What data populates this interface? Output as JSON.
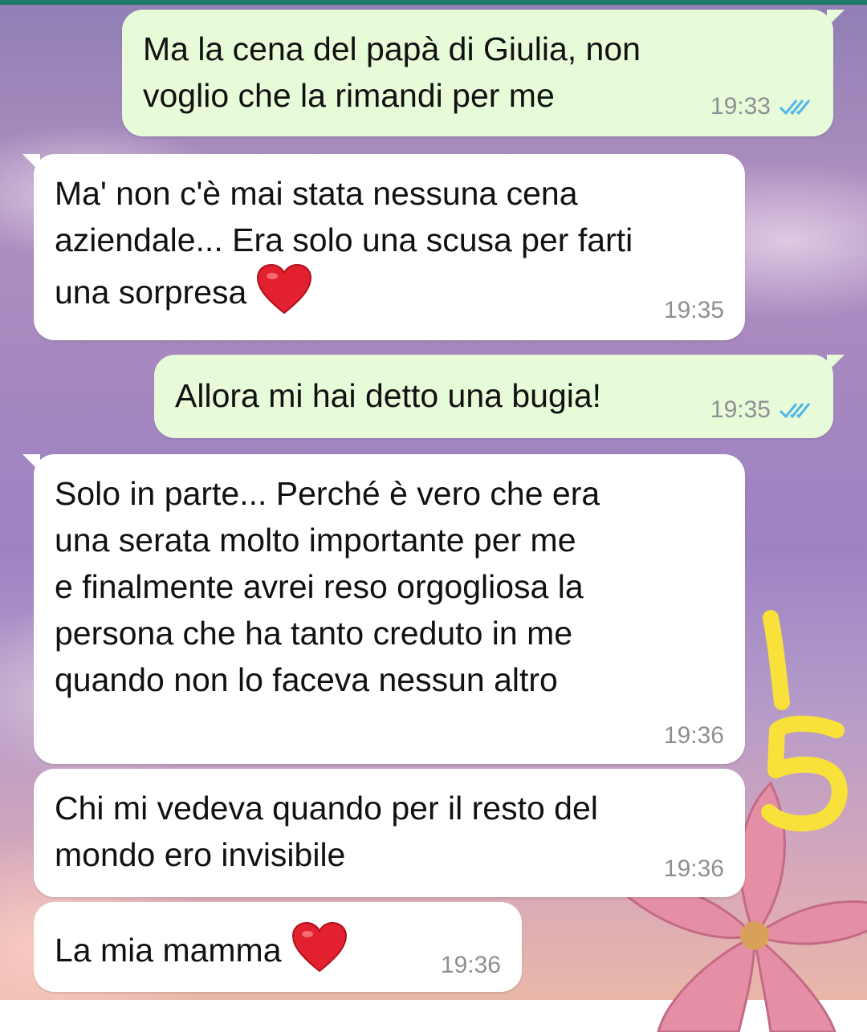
{
  "messages": [
    {
      "text": "Ma la cena del papà di Giulia, non\nvoglio che la rimandi per me",
      "time": "19:33",
      "direction": "outgoing",
      "status": "read"
    },
    {
      "text": "Ma' non c'è mai stata nessuna cena\naziendale... Era solo una scusa per farti\nuna sorpresa",
      "emoji": "heart",
      "time": "19:35",
      "direction": "incoming"
    },
    {
      "text": "Allora mi hai detto una bugia!",
      "time": "19:35",
      "direction": "outgoing",
      "status": "read"
    },
    {
      "text": "Solo in parte... Perché è vero che era\nuna serata molto importante per me\ne finalmente avrei reso orgogliosa la\npersona che ha tanto creduto in me\nquando non lo faceva nessun altro",
      "time": "19:36",
      "direction": "incoming"
    },
    {
      "text": "Chi mi vedeva quando per il resto del\nmondo ero invisibile",
      "time": "19:36",
      "direction": "incoming"
    },
    {
      "text": "La mia mamma",
      "emoji": "heart",
      "time": "19:36",
      "direction": "incoming"
    }
  ],
  "annotation": {
    "text": "15",
    "color": "#f7e13a"
  },
  "colors": {
    "outgoing_bubble": "#e7fbd9",
    "incoming_bubble": "#ffffff",
    "read_ticks": "#4fb6ec",
    "header_bar": "#1f7a6c"
  }
}
